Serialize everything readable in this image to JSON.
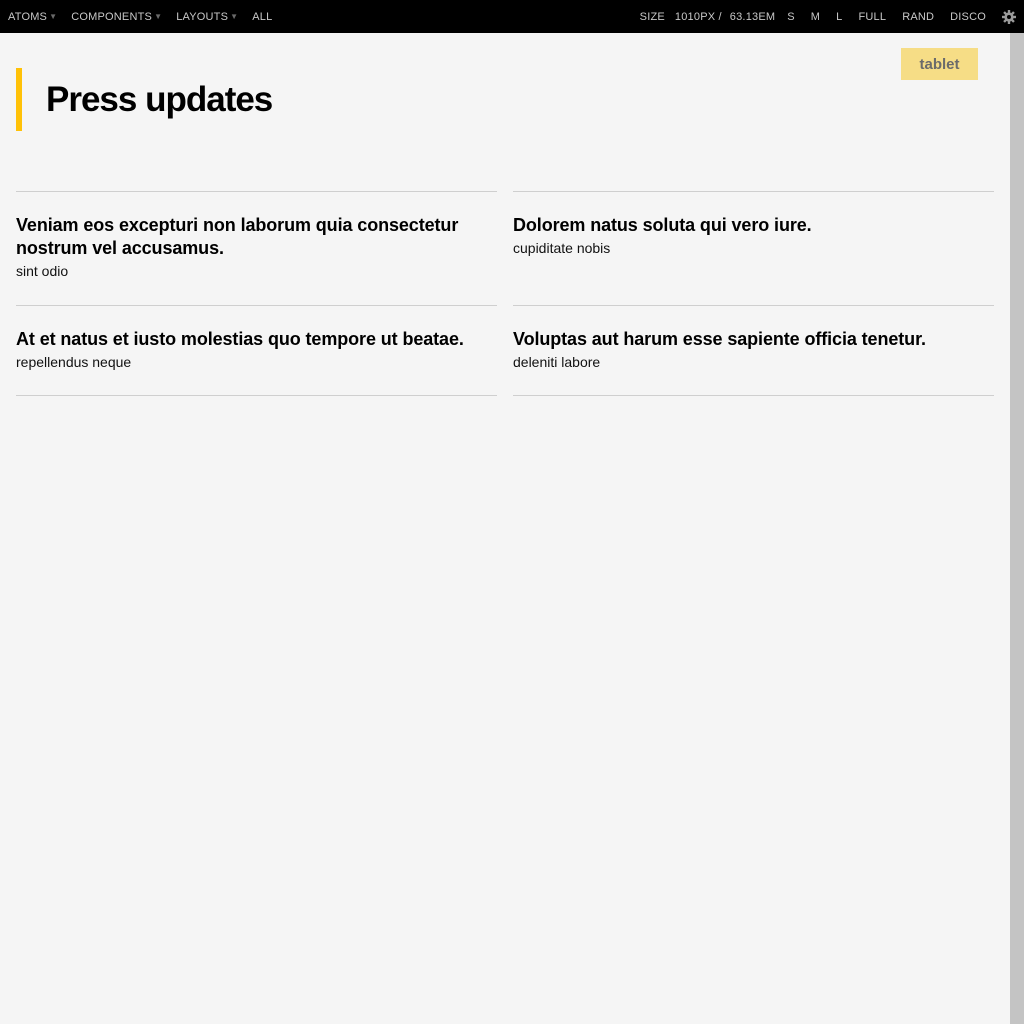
{
  "topbar": {
    "menus": [
      {
        "label": "ATOMS",
        "has_caret": true
      },
      {
        "label": "COMPONENTS",
        "has_caret": true
      },
      {
        "label": "LAYOUTS",
        "has_caret": true
      },
      {
        "label": "ALL",
        "has_caret": false
      }
    ],
    "size_label": "SIZE",
    "size_px": "1010",
    "px_unit": "PX /",
    "size_em": "63.13",
    "em_unit": "EM",
    "size_buttons": [
      "S",
      "M",
      "L",
      "FULL",
      "RAND",
      "DISCO"
    ],
    "settings_icon": "gear-icon"
  },
  "badge": "tablet",
  "page_title": "Press updates",
  "items": [
    {
      "title": "Veniam eos excepturi non laborum quia consectetur nostrum vel accusamus.",
      "sub": "sint odio"
    },
    {
      "title": "Dolorem natus soluta qui vero iure.",
      "sub": "cupiditate nobis"
    },
    {
      "title": "At et natus et iusto molestias quo tempore ut beatae.",
      "sub": "repellendus neque"
    },
    {
      "title": "Voluptas aut harum esse sapiente officia tenetur.",
      "sub": "deleniti labore"
    }
  ],
  "colors": {
    "accent": "#ffc107",
    "badge_bg": "#f6dd86",
    "topbar_bg": "#000000",
    "page_bg": "#f5f5f5"
  }
}
